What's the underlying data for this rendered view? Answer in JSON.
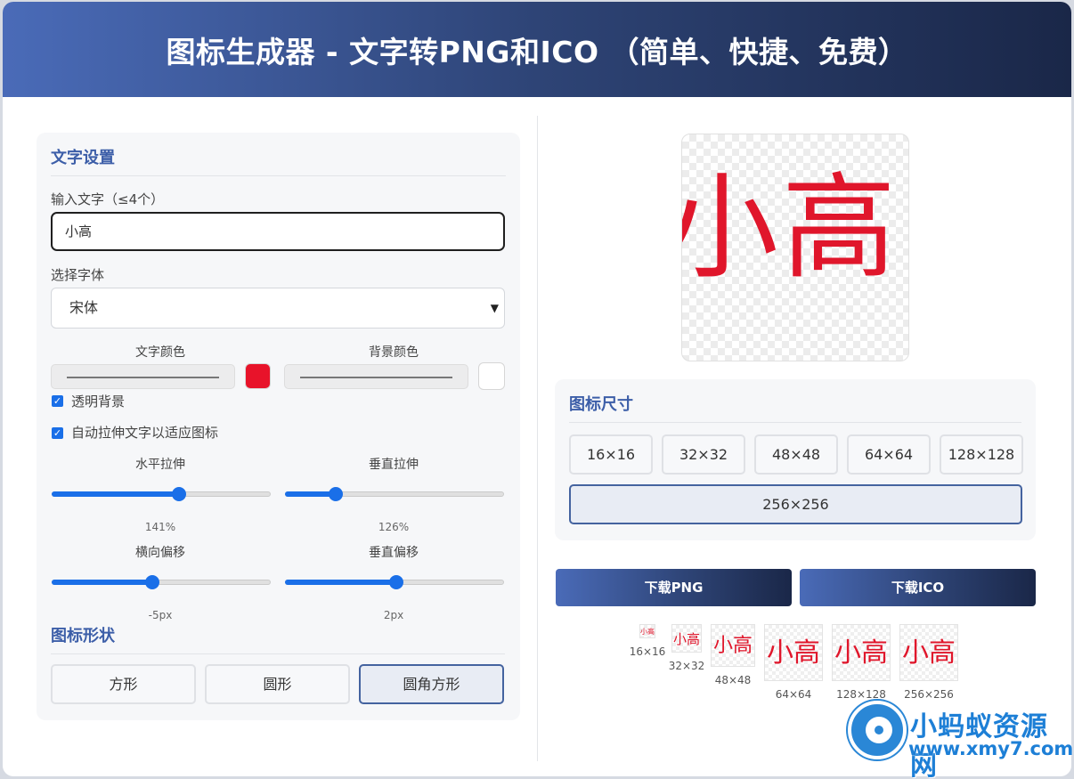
{
  "header": {
    "title": "图标生成器 - 文字转PNG和ICO （简单、快捷、免费）"
  },
  "text_settings": {
    "section_title": "文字设置",
    "input_label": "输入文字（≤4个）",
    "input_value": "小高",
    "font_label": "选择字体",
    "font_value": "宋体",
    "text_color_label": "文字颜色",
    "text_color": "#e8132a",
    "bg_color_label": "背景颜色",
    "bg_color": "#ffffff",
    "transparent_label": "透明背景",
    "transparent_checked": true,
    "autostretch_label": "自动拉伸文字以适应图标",
    "autostretch_checked": true,
    "h_stretch_label": "水平拉伸",
    "h_stretch_value": "141%",
    "h_stretch_pos": 0.58,
    "v_stretch_label": "垂直拉伸",
    "v_stretch_value": "126%",
    "v_stretch_pos": 0.23,
    "h_offset_label": "横向偏移",
    "h_offset_value": "-5px",
    "h_offset_pos": 0.46,
    "v_offset_label": "垂直偏移",
    "v_offset_value": "2px",
    "v_offset_pos": 0.51
  },
  "shape": {
    "section_title": "图标形状",
    "options": [
      "方形",
      "圆形",
      "圆角方形"
    ],
    "selected": "圆角方形"
  },
  "preview": {
    "text": "小高"
  },
  "sizes": {
    "section_title": "图标尺寸",
    "options": [
      "16×16",
      "32×32",
      "48×48",
      "64×64",
      "128×128",
      "256×256"
    ],
    "selected": "256×256"
  },
  "download": {
    "png_label": "下载PNG",
    "ico_label": "下载ICO"
  },
  "thumbnails": {
    "text": "小高",
    "captions": [
      "16×16",
      "32×32",
      "48×48",
      "64×64",
      "128×128",
      "256×256"
    ]
  },
  "watermark": {
    "title": "小蚂蚁资源网",
    "url": "www.xmy7.com"
  }
}
